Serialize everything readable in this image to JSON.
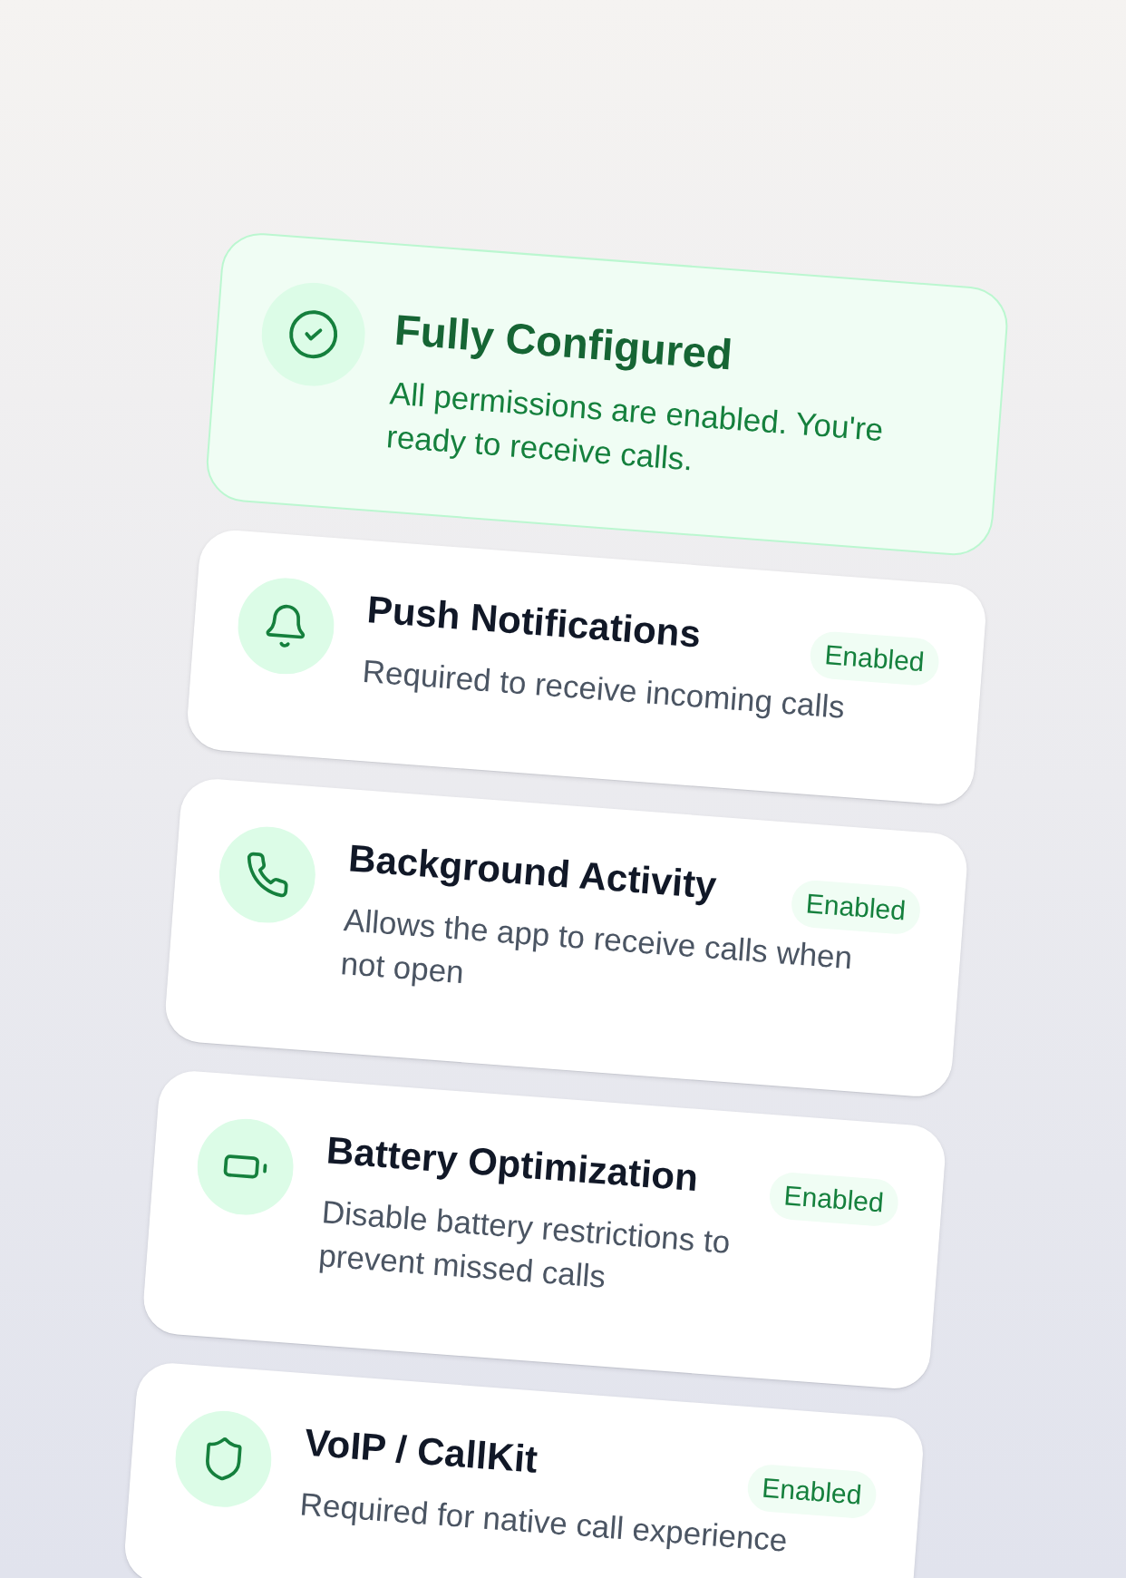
{
  "summary": {
    "title": "Fully Configured",
    "description": "All permissions are enabled. You're ready to receive calls.",
    "complete": true
  },
  "permissions": [
    {
      "title": "Push Notifications",
      "description": "Required to receive incoming calls",
      "status": "Enabled",
      "enabled": true
    },
    {
      "title": "Background Activity",
      "description": "Allows the app to receive calls when not open",
      "status": "Enabled",
      "enabled": true
    },
    {
      "title": "Battery Optimization",
      "description": "Disable battery restrictions to prevent missed calls",
      "status": "Enabled",
      "enabled": true
    },
    {
      "title": "VoIP / CallKit",
      "description": "Required for native call experience",
      "status": "Enabled",
      "enabled": true
    }
  ]
}
